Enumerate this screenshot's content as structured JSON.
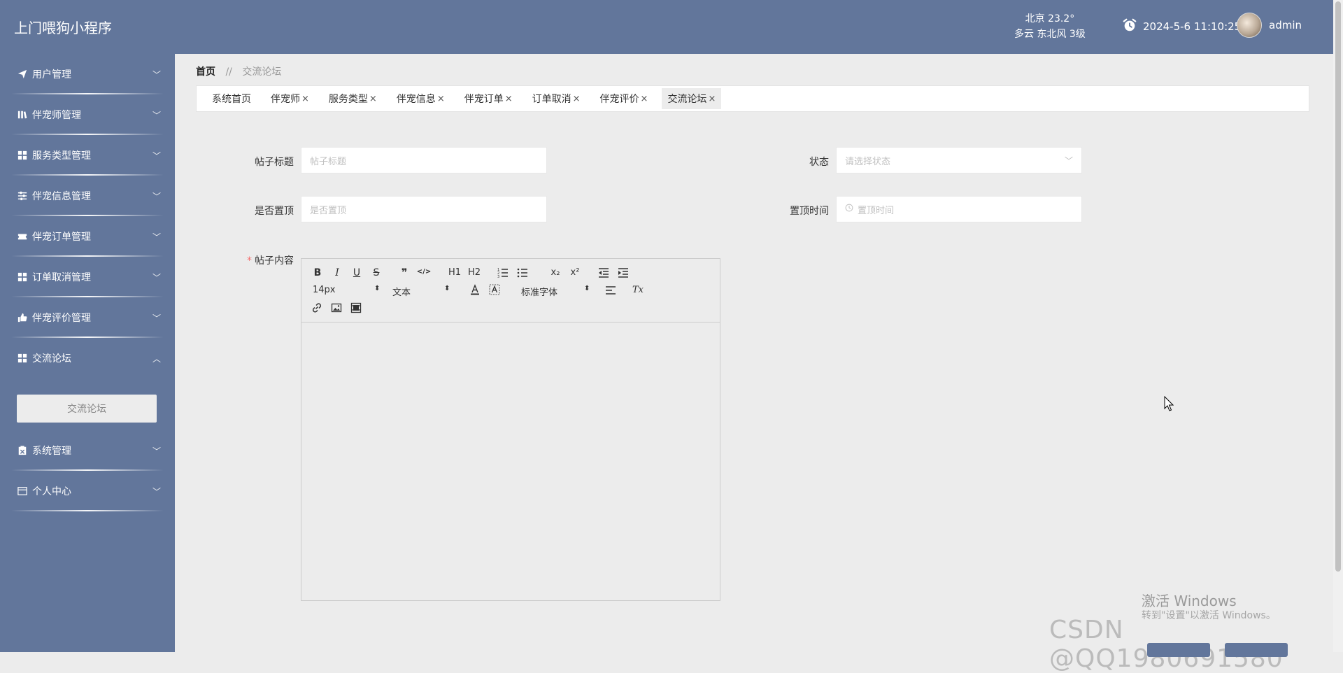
{
  "header": {
    "app_title": "上门喂狗小程序",
    "weather": {
      "city_temp": "北京  23.2°",
      "detail": "多云  东北风  3级"
    },
    "clock": {
      "datetime": "2024-5-6 11:10:25",
      "icon": "alarm-clock-icon"
    },
    "user": {
      "name": "admin"
    }
  },
  "sidebar": {
    "items": [
      {
        "label": "用户管理",
        "icon": "paper-plane-icon"
      },
      {
        "label": "伴宠师管理",
        "icon": "library-icon"
      },
      {
        "label": "服务类型管理",
        "icon": "grid-icon"
      },
      {
        "label": "伴宠信息管理",
        "icon": "sliders-icon"
      },
      {
        "label": "伴宠订单管理",
        "icon": "ticket-icon"
      },
      {
        "label": "订单取消管理",
        "icon": "grid-icon"
      },
      {
        "label": "伴宠评价管理",
        "icon": "thumbs-up-icon"
      },
      {
        "label": "交流论坛",
        "icon": "grid-icon"
      },
      {
        "label": "系统管理",
        "icon": "clipboard-icon"
      },
      {
        "label": "个人中心",
        "icon": "card-icon"
      }
    ],
    "sub_item": "交流论坛"
  },
  "breadcrumb": {
    "home": "首页",
    "separator": "//",
    "current": "交流论坛"
  },
  "tabs": [
    {
      "label": "系统首页",
      "closable": false
    },
    {
      "label": "伴宠师",
      "closable": true
    },
    {
      "label": "服务类型",
      "closable": true
    },
    {
      "label": "伴宠信息",
      "closable": true
    },
    {
      "label": "伴宠订单",
      "closable": true
    },
    {
      "label": "订单取消",
      "closable": true
    },
    {
      "label": "伴宠评价",
      "closable": true
    },
    {
      "label": "交流论坛",
      "closable": true,
      "active": true
    }
  ],
  "tab_close": "×",
  "form": {
    "title_label": "帖子标题",
    "title_placeholder": "帖子标题",
    "status_label": "状态",
    "status_placeholder": "请选择状态",
    "top_label": "是否置顶",
    "top_placeholder": "是否置顶",
    "top_time_label": "置顶时间",
    "top_time_placeholder": "置顶时间",
    "content_label": "帖子内容",
    "required_mark": "*"
  },
  "editor": {
    "size_select": "14px",
    "text_select": "文本",
    "font_select": "标准字体",
    "buttons": {
      "bold": "B",
      "italic": "I",
      "underline": "U",
      "strike": "S",
      "quote": "❞",
      "code": "</>",
      "h1": "H1",
      "h2": "H2",
      "sub": "x₂",
      "sup": "x²",
      "clear": "Tx"
    }
  },
  "watermarks": {
    "activate": "激活 Windows",
    "activate_sub": "转到\"设置\"以激活 Windows。",
    "csdn": "CSDN @QQ1980691580"
  }
}
